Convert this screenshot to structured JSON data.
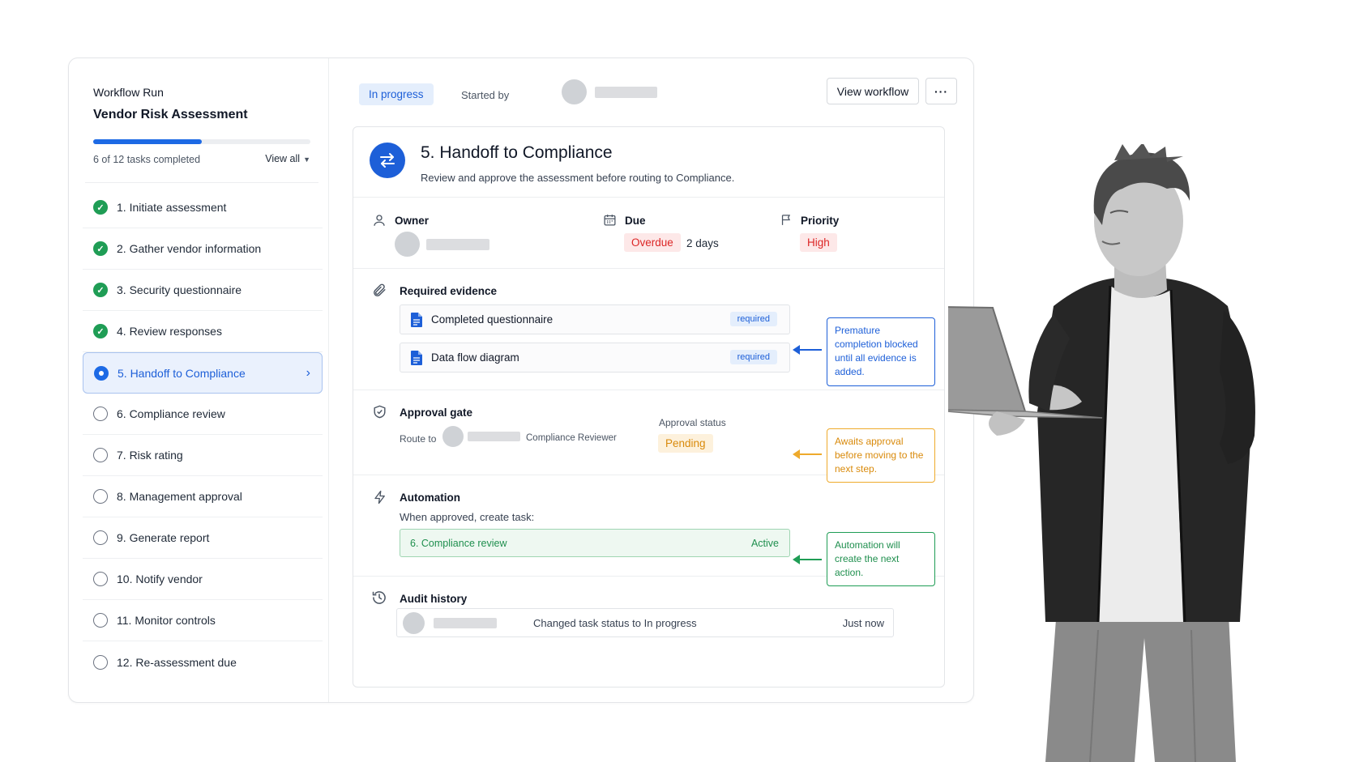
{
  "sidebar": {
    "eyebrow": "Workflow Run",
    "title": "Vendor Risk Assessment",
    "progress_fraction": 0.5,
    "count_text": "6 of 12 tasks completed",
    "view_all": "View all",
    "tasks": [
      {
        "label": "1. Initiate assessment",
        "state": "done"
      },
      {
        "label": "2. Gather vendor information",
        "state": "done"
      },
      {
        "label": "3. Security questionnaire",
        "state": "done"
      },
      {
        "label": "4. Review responses",
        "state": "done"
      },
      {
        "label": "5. Handoff to Compliance",
        "state": "current"
      },
      {
        "label": "6. Compliance review",
        "state": "todo"
      },
      {
        "label": "7. Risk rating",
        "state": "todo"
      },
      {
        "label": "8. Management approval",
        "state": "todo"
      },
      {
        "label": "9. Generate report",
        "state": "todo"
      },
      {
        "label": "10. Notify vendor",
        "state": "todo"
      },
      {
        "label": "11. Monitor controls",
        "state": "todo"
      },
      {
        "label": "12. Re-assessment due",
        "state": "todo"
      }
    ]
  },
  "topbar": {
    "status": "In progress",
    "started_by": "Started by",
    "view_workflow": "View workflow",
    "more": "···"
  },
  "task": {
    "title": "5. Handoff to Compliance",
    "subtitle": "Review and approve the assessment before routing to Compliance.",
    "owner_label": "Owner",
    "due_label": "Due",
    "due_status": "Overdue",
    "due_value": "2 days",
    "priority_label": "Priority",
    "priority_value": "High"
  },
  "evidence": {
    "label": "Required evidence",
    "items": [
      {
        "name": "Completed questionnaire",
        "tag": "required"
      },
      {
        "name": "Data flow diagram",
        "tag": "required"
      }
    ]
  },
  "approval": {
    "label": "Approval gate",
    "route_to": "Route to",
    "reviewer_role": "Compliance Reviewer",
    "status_label": "Approval status",
    "status_value": "Pending"
  },
  "automation": {
    "label": "Automation",
    "rule": "When approved, create task:",
    "task_name": "6. Compliance review",
    "task_status": "Active"
  },
  "audit": {
    "label": "Audit history",
    "entry_text": "Changed task status to In progress",
    "entry_time": "Just now"
  },
  "callouts": {
    "evidence": "Premature completion blocked until all evidence is added.",
    "approval": "Awaits approval before moving to the next step.",
    "automation": "Automation will create the next action."
  },
  "colors": {
    "accent": "#1d5fd8",
    "success": "#1f9d55",
    "warning": "#d98a0b",
    "danger": "#dc2626"
  }
}
